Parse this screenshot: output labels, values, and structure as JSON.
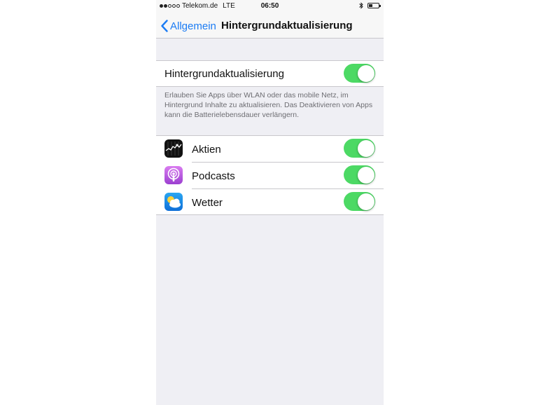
{
  "status_bar": {
    "carrier": "Telekom.de",
    "network": "LTE",
    "time": "06:50",
    "signal_bars_filled": 2,
    "signal_bars_total": 5,
    "battery_level": 0.35
  },
  "nav": {
    "back_label": "Allgemein",
    "title": "Hintergrundaktualisierung"
  },
  "main_toggle": {
    "label": "Hintergrundaktualisierung",
    "on": true
  },
  "footer": "Erlauben Sie Apps über WLAN oder das mobile Netz, im Hintergrund Inhalte zu aktualisieren. Das Deaktivieren von Apps kann die Batterielebensdauer verlängern.",
  "apps": [
    {
      "label": "Aktien",
      "icon": "stocks-icon",
      "on": true
    },
    {
      "label": "Podcasts",
      "icon": "podcasts-icon",
      "on": true
    },
    {
      "label": "Wetter",
      "icon": "weather-icon",
      "on": true
    }
  ],
  "colors": {
    "toggle_on": "#4cd964",
    "link_blue": "#1c7cf4",
    "background": "#efeff4"
  }
}
